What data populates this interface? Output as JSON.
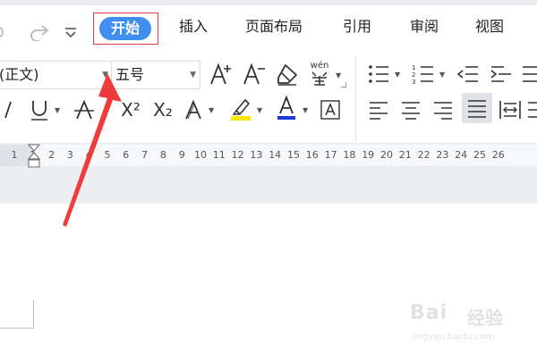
{
  "tabs": {
    "home": "开始",
    "insert": "插入",
    "page_layout": "页面布局",
    "references": "引用",
    "review": "审阅",
    "view": "视图"
  },
  "quick_access": {
    "redo_icon": "redo-icon",
    "customize_icon": "chevron-down-icon"
  },
  "font": {
    "name": "(正文)",
    "size": "五号"
  },
  "toolbar_icons": [
    "increase-font-size-icon",
    "decrease-font-size-icon",
    "clear-format-icon",
    "pinyin-guide-icon",
    "italic-icon",
    "underline-icon",
    "strikethrough-icon",
    "superscript-icon",
    "subscript-icon",
    "text-effect-icon",
    "highlight-icon",
    "font-color-icon",
    "character-border-icon",
    "bullets-icon",
    "numbering-icon",
    "decrease-indent-icon",
    "increase-indent-icon",
    "align-left-icon",
    "align-center-icon",
    "align-right-icon",
    "justify-icon",
    "distributed-icon"
  ],
  "labels": {
    "pinyin": "wén",
    "a": "A",
    "superscript": "X²",
    "subscript": "X₂"
  },
  "colors": {
    "accent_tab": "#3f8ef0",
    "highlight_box": "#e23b3b",
    "arrow": "#ef3b3b",
    "highlight_yellow": "#ffe600",
    "font_color_blue": "#1a3bd6"
  },
  "ruler": {
    "numbers": [
      "1",
      "1",
      "2",
      "3",
      "4",
      "5",
      "6",
      "7",
      "8",
      "9",
      "10",
      "11",
      "12",
      "13",
      "14",
      "15",
      "16",
      "17",
      "18",
      "19",
      "20",
      "21",
      "22",
      "23",
      "24",
      "25",
      "26"
    ]
  },
  "watermark": {
    "logo": "Bai",
    "logo2": "经验",
    "url": "jingyan.baidu.com"
  }
}
